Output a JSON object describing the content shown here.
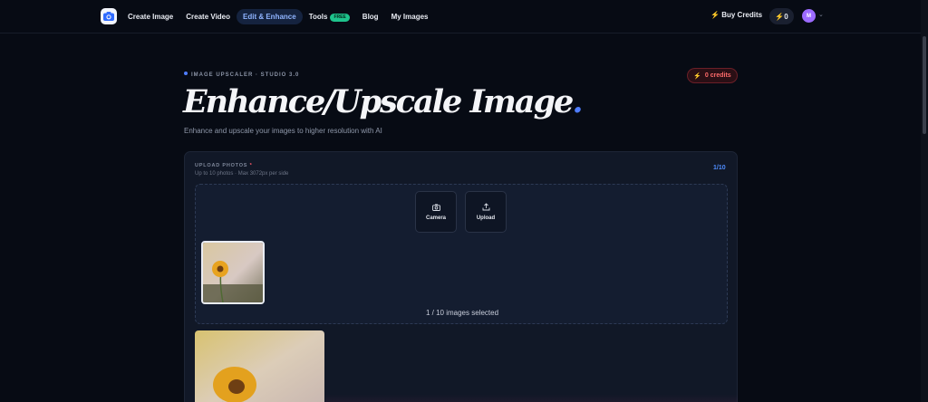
{
  "nav": {
    "links": [
      {
        "label": "Create Image",
        "active": false
      },
      {
        "label": "Create Video",
        "active": false
      },
      {
        "label": "Edit & Enhance",
        "active": true
      },
      {
        "label": "Tools",
        "active": false,
        "badge": "FREE"
      },
      {
        "label": "Blog",
        "active": false
      },
      {
        "label": "My Images",
        "active": false
      }
    ],
    "buy_credits": "Buy Credits",
    "credit_balance": "0",
    "avatar_initial": "M"
  },
  "header": {
    "eyebrow": "IMAGE UPSCALER · STUDIO 3.0",
    "credits_badge": "0 credits",
    "title": "Enhance/Upscale Image",
    "title_dot": ".",
    "subtitle": "Enhance and upscale your images to higher resolution with AI"
  },
  "upload": {
    "label": "UPLOAD PHOTOS",
    "required_mark": "*",
    "hint": "Up to 10 photos · Max 3072px per side",
    "count": "1/10",
    "camera_label": "Camera",
    "upload_label": "Upload",
    "selected_text": "1 / 10 images selected"
  },
  "colors": {
    "accent": "#4f7dff",
    "background": "#070b14",
    "card": "#111827",
    "danger": "#ff6b6b",
    "free_badge": "#1ec38c"
  },
  "icons": [
    "logo-camera-icon",
    "bolt-icon",
    "chevron-down-icon",
    "camera-icon",
    "upload-icon"
  ]
}
